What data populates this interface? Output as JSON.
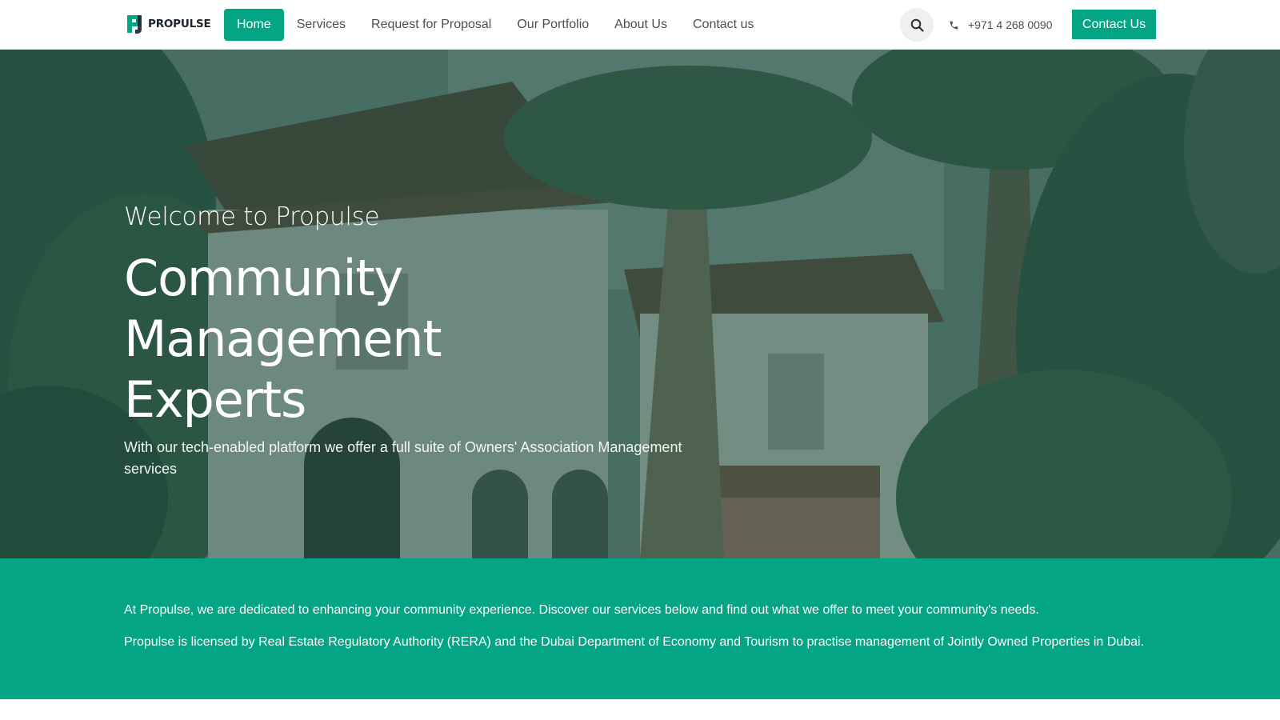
{
  "brand": {
    "name": "PROPULSE",
    "accent_color": "#04a585",
    "icon": "propulse-logo-icon"
  },
  "nav": {
    "items": [
      {
        "label": "Home",
        "active": true
      },
      {
        "label": "Services",
        "active": false
      },
      {
        "label": "Request for Proposal",
        "active": false
      },
      {
        "label": "Our Portfolio",
        "active": false
      },
      {
        "label": "About Us",
        "active": false
      },
      {
        "label": "Contact us",
        "active": false
      }
    ]
  },
  "header": {
    "search_icon": "search-icon",
    "phone_icon": "phone-icon",
    "phone": "+971 4 268 0090",
    "cta_label": "Contact Us"
  },
  "hero": {
    "subtitle": "Welcome to Propulse",
    "title_line1": "Community Management",
    "title_line2": "Experts",
    "description": "With our tech-enabled platform we offer a full suite of Owners' Association Management services"
  },
  "info": {
    "paragraph1": "At Propulse, we are dedicated to enhancing your community experience. Discover our services below and find out what we offer to meet your community's needs.",
    "paragraph2": "Propulse is licensed by Real Estate Regulatory Authority (RERA) and the Dubai Department of Economy and Tourism to practise management of Jointly Owned Properties in Dubai."
  }
}
